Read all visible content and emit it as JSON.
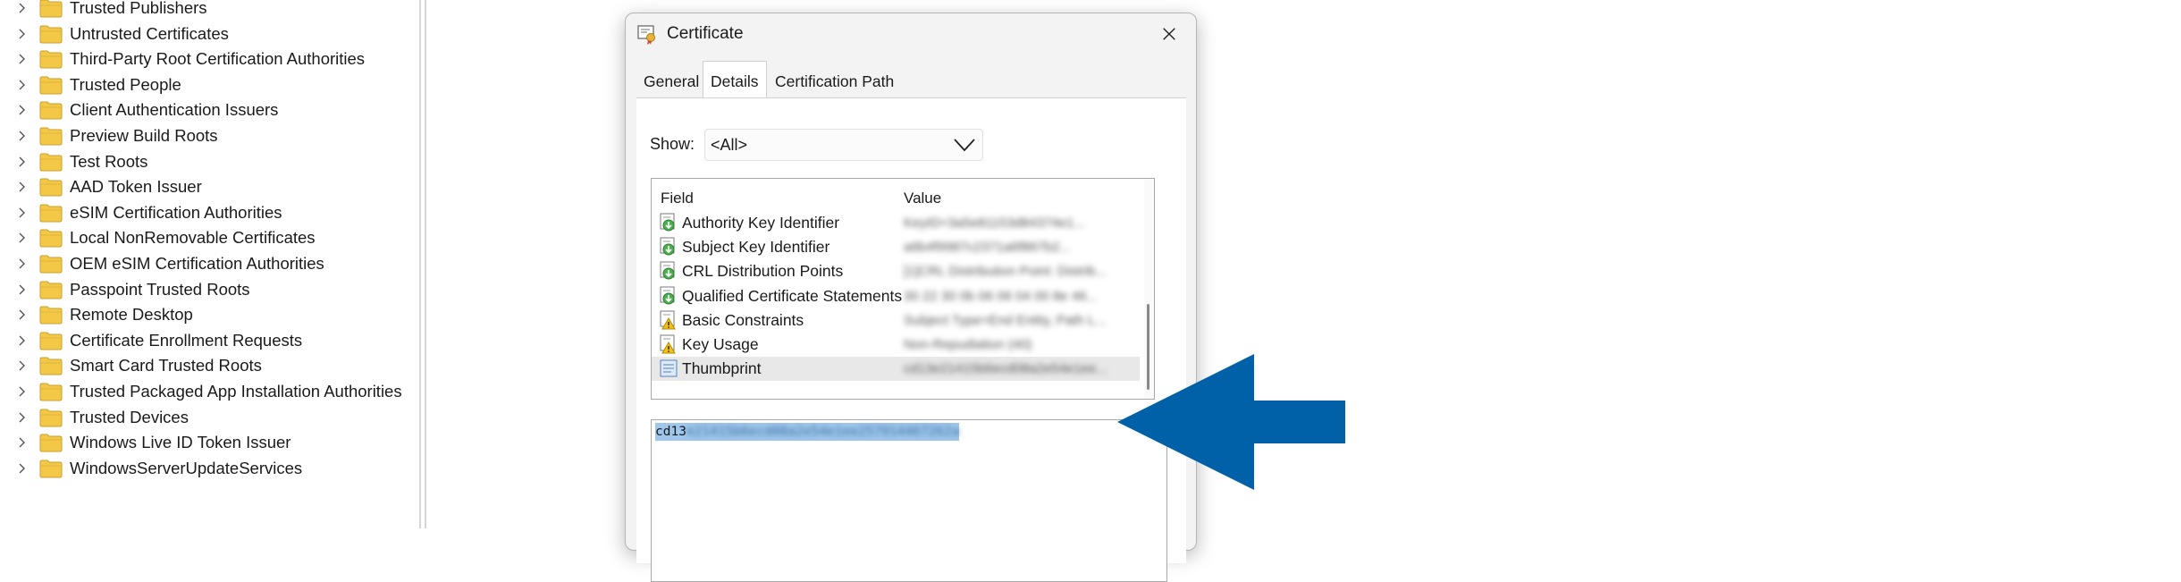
{
  "tree": {
    "items": [
      "Trusted Publishers",
      "Untrusted Certificates",
      "Third-Party Root Certification Authorities",
      "Trusted People",
      "Client Authentication Issuers",
      "Preview Build Roots",
      "Test Roots",
      "AAD Token Issuer",
      "eSIM Certification Authorities",
      "Local NonRemovable Certificates",
      "OEM eSIM Certification Authorities",
      "Passpoint Trusted Roots",
      "Remote Desktop",
      "Certificate Enrollment Requests",
      "Smart Card Trusted Roots",
      "Trusted Packaged App Installation Authorities",
      "Trusted Devices",
      "Windows Live ID Token Issuer",
      "WindowsServerUpdateServices"
    ]
  },
  "dialog": {
    "title": "Certificate",
    "tabs": [
      "General",
      "Details",
      "Certification Path"
    ],
    "active_tab": "Details",
    "show_label": "Show:",
    "show_value": "<All>",
    "columns": {
      "field": "Field",
      "value": "Value"
    },
    "rows": [
      {
        "field": "Authority Key Identifier",
        "value": "KeyID=3a5e81153d84374e1...",
        "icon": "certificate-extension-icon"
      },
      {
        "field": "Subject Key Identifier",
        "value": "a6b4f9987c2371a6f867b2...",
        "icon": "certificate-extension-icon"
      },
      {
        "field": "CRL Distribution Points",
        "value": "[1]CRL Distribution Point: Distrib...",
        "icon": "certificate-extension-icon"
      },
      {
        "field": "Qualified Certificate Statements",
        "value": "30 22 30 0b 06 06 04 00 8e 46...",
        "icon": "certificate-extension-icon"
      },
      {
        "field": "Basic Constraints",
        "value": "Subject Type=End Entity, Path L...",
        "icon": "critical-extension-icon"
      },
      {
        "field": "Key Usage",
        "value": "Non-Repudiation (40)",
        "icon": "critical-extension-icon"
      },
      {
        "field": "Thumbprint",
        "value": "cd13e21415b6ecd08a2e54e1ee...",
        "icon": "thumbprint-icon"
      }
    ],
    "selected_row": "Thumbprint",
    "value_text_visible": "cd13",
    "value_text_hidden": "e21415b6ecd08a2e54e1ee257914467262a"
  },
  "colors": {
    "arrow": "#0060a8",
    "selection": "#9fc7ec",
    "folder": "#f3c847"
  }
}
